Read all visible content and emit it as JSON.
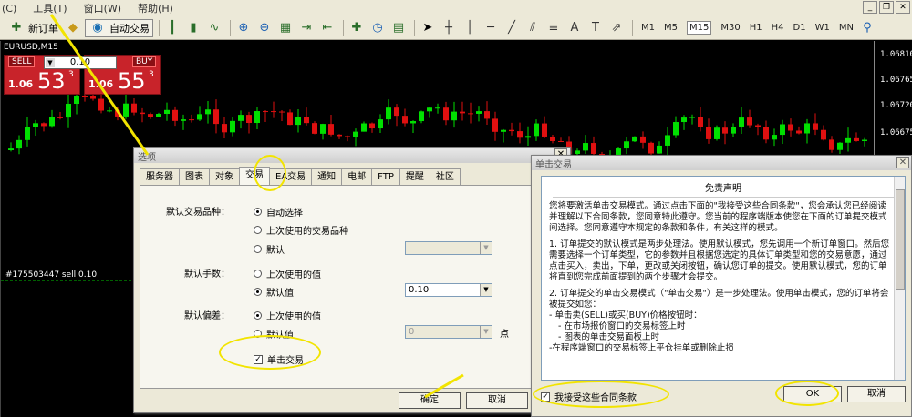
{
  "menu": {
    "items": [
      "(C)",
      "工具(T)",
      "窗口(W)",
      "帮助(H)"
    ]
  },
  "toolbar": {
    "new_order": "新订单",
    "auto_trade": "自动交易",
    "timeframes": [
      "M1",
      "M5",
      "M15",
      "M30",
      "H1",
      "H4",
      "D1",
      "W1",
      "MN"
    ],
    "active_timeframe": "M15"
  },
  "chart": {
    "symbol": "EURUSD,M15",
    "order_line": "#175503447 sell 0.10",
    "prices": [
      "1.06810",
      "1.06765",
      "1.06720",
      "1.06675"
    ]
  },
  "one_click": {
    "sell_label": "SELL",
    "buy_label": "BUY",
    "lot": "0.10",
    "sell_prefix": "1.06",
    "sell_big": "53",
    "sell_sup": "3",
    "buy_prefix": "1.06",
    "buy_big": "55",
    "buy_sup": "3"
  },
  "options_dialog": {
    "title": "选项",
    "tabs": [
      "服务器",
      "图表",
      "对象",
      "交易",
      "EA交易",
      "通知",
      "电邮",
      "FTP",
      "提醒",
      "社区"
    ],
    "active_tab": "交易",
    "default_symbol_label": "默认交易品种：",
    "symbol_auto": "自动选择",
    "symbol_last": "上次使用的交易品种",
    "symbol_default": "默认",
    "default_lot_label": "默认手数：",
    "lot_last": "上次使用的值",
    "lot_default": "默认值",
    "lot_value": "0.10",
    "default_deviation_label": "默认偏差：",
    "dev_last": "上次使用的值",
    "dev_default": "默认值",
    "dev_value": "0",
    "dev_unit": "点",
    "one_click_label": "单击交易",
    "ok": "确定",
    "cancel": "取消"
  },
  "disclaimer_dialog": {
    "title": "单击交易",
    "heading": "免责声明",
    "p1": "您将要激活单击交易模式。通过点击下面的\"我接受这些合同条款\"，您会承认您已经阅读并理解以下合同条款，您同意特此遵守。您当前的程序端版本使您在下面的订单提交模式间选择。您同意遵守本规定的条款和条件，有关这样的模式。",
    "p2": "1. 订单提交的默认模式是两步处理法。使用默认模式，您先调用一个新订单窗口。然后您需要选择一个订单类型，它的参数并且根据您选定的具体订单类型和您的交易意愿，通过点击买入，卖出，下单，更改或关闭按钮，确认您订单的提交。使用默认模式，您的订单将直到您完成前面提到的两个步骤才会提交。",
    "p3": "2. 订单提交的单击交易模式（\"单击交易\"）是一步处理法。使用单击模式，您的订单将会被提交如您：",
    "p3a": "- 单击卖(SELL)或买(BUY)价格按钮时：",
    "p3b": "- 在市场报价窗口的交易标签上时",
    "p3c": "- 图表的单击交易面板上时",
    "p3d": "-在程序端窗口的交易标签上平仓挂单或删除止损",
    "accept": "我接受这些合同条款",
    "ok": "OK",
    "cancel": "取消"
  }
}
